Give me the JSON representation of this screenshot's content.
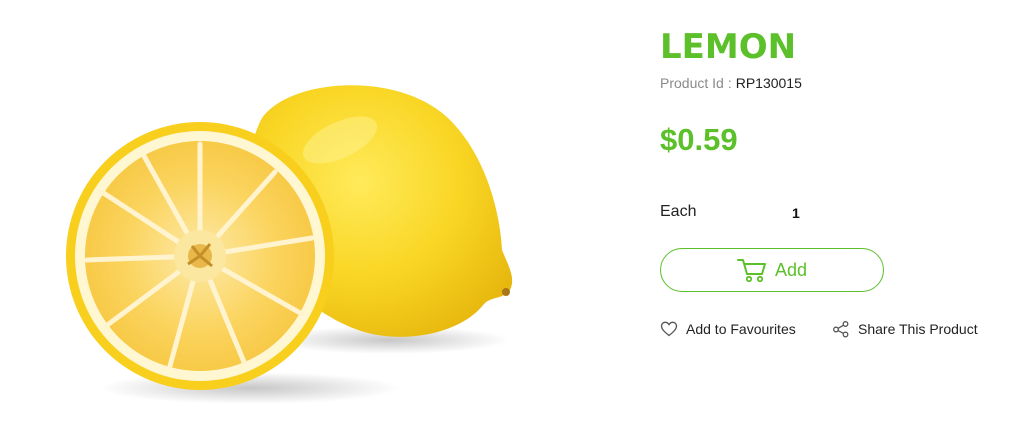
{
  "product": {
    "name": "Lemon",
    "id_label": "Product Id",
    "id_separator": ":",
    "id_value": "RP130015",
    "price": "$0.59",
    "unit": "Each",
    "quantity": "1",
    "image_icon": "lemon-image"
  },
  "actions": {
    "add_label": "Add",
    "add_icon": "cart-icon",
    "favourite_label": "Add to Favourites",
    "favourite_icon": "heart-icon",
    "share_label": "Share This Product",
    "share_icon": "share-icon"
  },
  "colors": {
    "brand_green": "#5cc02a",
    "lemon_yellow": "#f7d21a",
    "lemon_flesh": "#fbd35a"
  }
}
